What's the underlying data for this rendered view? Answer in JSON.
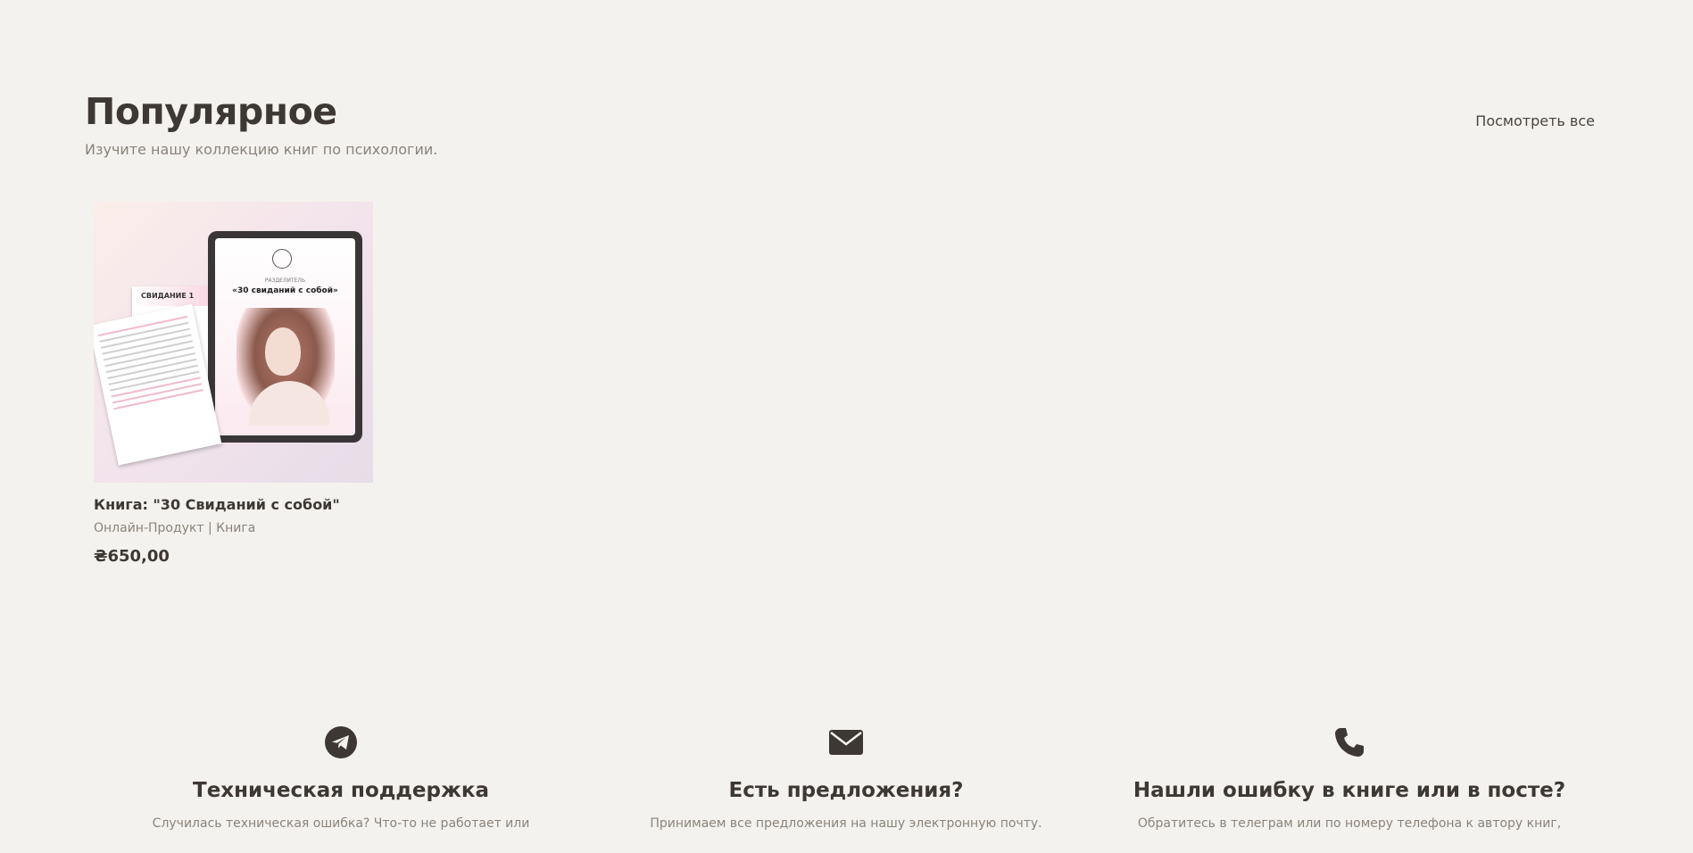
{
  "popular": {
    "title": "Популярное",
    "subtitle": "Изучите нашу коллекцию книг по психологии.",
    "view_all": "Посмотреть все"
  },
  "product": {
    "title": "Книга: \"30 Свиданий с собой\"",
    "category": "Онлайн-Продукт | Книга",
    "price": "₴650,00",
    "image_tablet_small": "РАЗДЕЛИТЕЛЬ",
    "image_tablet_title": "«30 свиданий с собой»",
    "image_paper_heading": "СВИДАНИЕ 1"
  },
  "features": [
    {
      "icon": "telegram-icon",
      "title": "Техническая поддержка",
      "text": "Случилась техническая ошибка? Что-то не работает или"
    },
    {
      "icon": "envelope-icon",
      "title": "Есть предложения?",
      "text": "Принимаем все предложения на нашу электронную почту."
    },
    {
      "icon": "phone-icon",
      "title": "Нашли ошибку в книге или в посте?",
      "text": "Обратитесь в телеграм или по номеру телефона к автору книг,"
    }
  ],
  "colors": {
    "background": "#f4f2ee",
    "text": "#3d3833",
    "muted": "#8a837c"
  }
}
